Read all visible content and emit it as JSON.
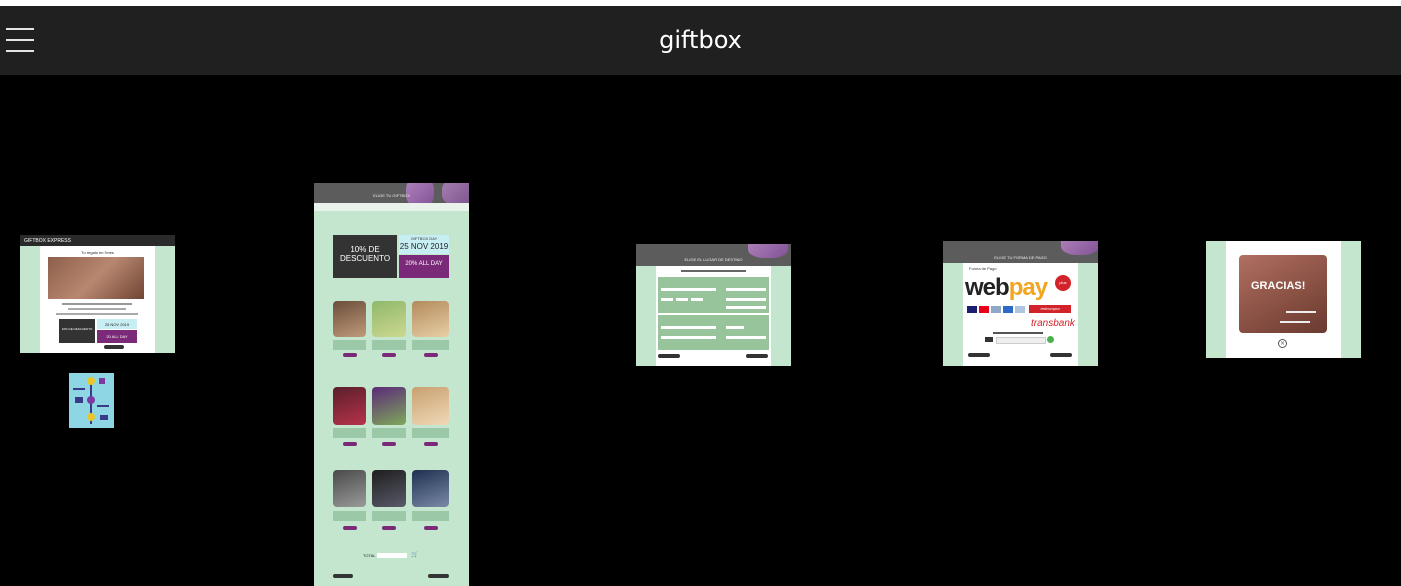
{
  "header": {
    "title": "giftbox",
    "menu_icon": "hamburger-menu-icon"
  },
  "colors": {
    "header_bg": "#202020",
    "canvas_bg": "#000000",
    "mint": "#c4e6cf",
    "purple": "#7a2a78",
    "dark": "#333333"
  },
  "thumbnails": {
    "home": {
      "brand": "GIFTBOX EXPRESS",
      "heading": "Tu regalo en l'mes",
      "discount": "10% DE DESCUENTO",
      "date": "25 NOV 2019",
      "promo": "20 ALL DAY"
    },
    "catalog": {
      "header": "ELIGE TU GIFTBOX",
      "discount_line1": "10% DE",
      "discount_line2": "DESCUENTO",
      "event_small": "GIFTBOX DAY",
      "date": "25 NOV 2019",
      "promo": "20% ALL DAY",
      "total_label": "TOTAL"
    },
    "destination": {
      "header": "ELIGE EL LUGAR DE DESTINO"
    },
    "payment": {
      "header": "ELIGE TU FORMA DE PAGO",
      "form_label": "Forma de Pago",
      "brand": "webpay",
      "plus_badge": "plus",
      "provider": "transbank",
      "red_compra": "redcompra"
    },
    "thanks": {
      "message": "GRACIAS!",
      "close_icon": "close-circle-icon"
    }
  }
}
